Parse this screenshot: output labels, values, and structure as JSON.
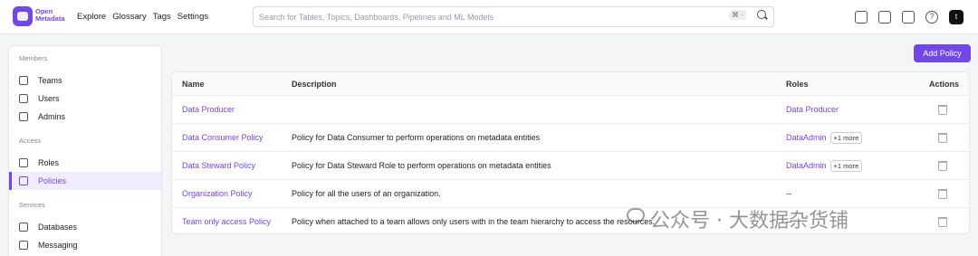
{
  "app": {
    "logo_line1": "Open",
    "logo_line2": "Metadata"
  },
  "nav": [
    "Explore",
    "Glossary",
    "Tags",
    "Settings"
  ],
  "search": {
    "placeholder": "Search for Tables, Topics, Dashboards, Pipelines and ML Models",
    "shortcut": "⌘ ·"
  },
  "user": {
    "avatar": "t"
  },
  "sidebar": {
    "sections": [
      {
        "title": "Members",
        "items": [
          {
            "label": "Teams",
            "icon": "team-icon"
          },
          {
            "label": "Users",
            "icon": "user-icon"
          },
          {
            "label": "Admins",
            "icon": "admin-icon"
          }
        ]
      },
      {
        "title": "Access",
        "items": [
          {
            "label": "Roles",
            "icon": "roles-icon"
          },
          {
            "label": "Policies",
            "icon": "policies-icon",
            "active": true
          }
        ]
      },
      {
        "title": "Services",
        "items": [
          {
            "label": "Databases",
            "icon": "database-icon"
          },
          {
            "label": "Messaging",
            "icon": "messaging-icon"
          }
        ]
      }
    ]
  },
  "actions": {
    "add_policy": "Add Policy"
  },
  "table": {
    "headers": [
      "Name",
      "Description",
      "Roles",
      "Actions"
    ],
    "rows": [
      {
        "name": "Data Producer",
        "description": "",
        "role": "Data Producer",
        "more": ""
      },
      {
        "name": "Data Consumer Policy",
        "description": "Policy for Data Consumer to perform operations on metadata entities",
        "role": "DataAdmin",
        "more": "+1 more"
      },
      {
        "name": "Data Steward Policy",
        "description": "Policy for Data Steward Role to perform operations on metadata entities",
        "role": "DataAdmin",
        "more": "+1 more"
      },
      {
        "name": "Organization Policy",
        "description": "Policy for all the users of an organization.",
        "role": "--",
        "more": ""
      },
      {
        "name": "Team only access Policy",
        "description": "Policy when attached to a team allows only users with in the team hierarchy to access the resources.",
        "role": "--",
        "more": ""
      }
    ]
  },
  "watermark": "公众号 · 大数据杂货铺"
}
